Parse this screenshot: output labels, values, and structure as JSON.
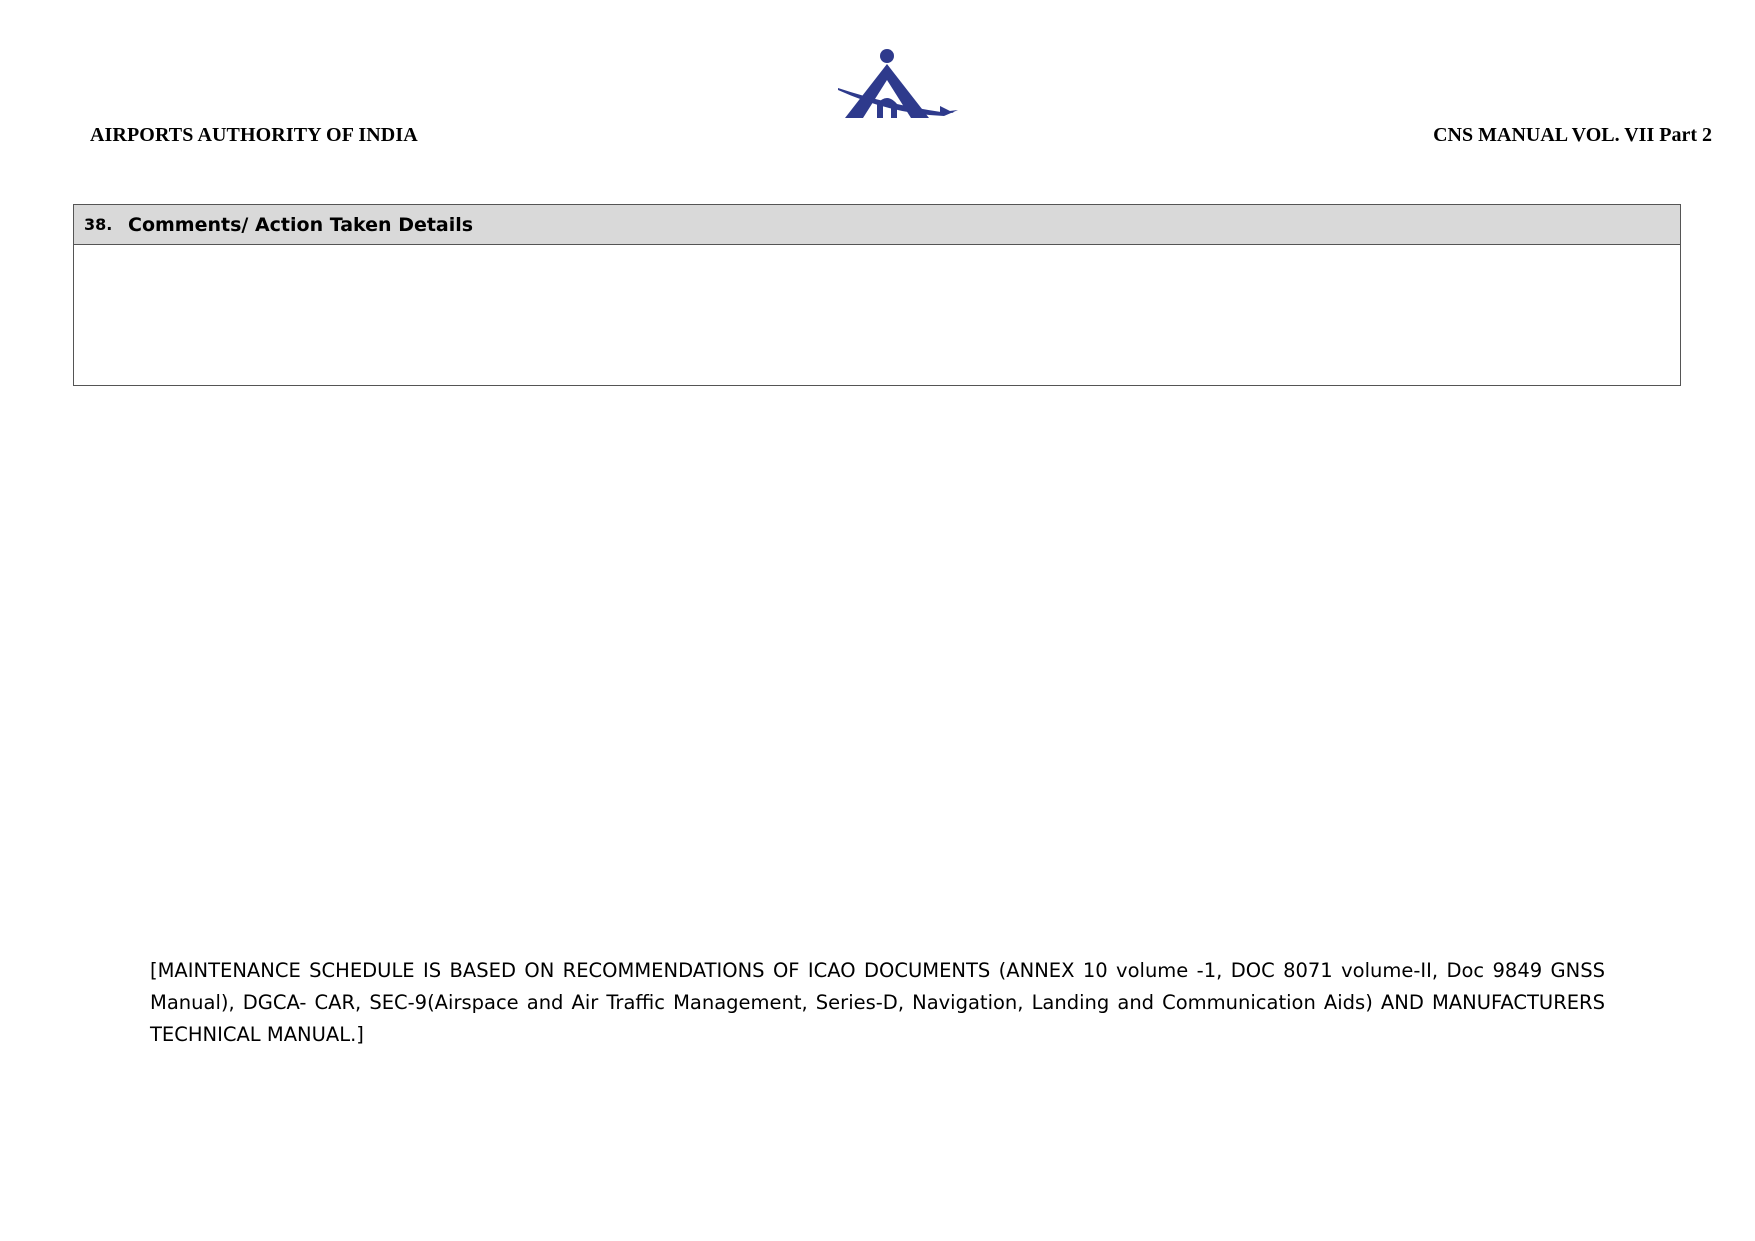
{
  "header": {
    "organization": "AIRPORTS AUTHORITY OF INDIA",
    "manual": "CNS MANUAL VOL. VII Part 2",
    "logo_color": "#2e3a8c"
  },
  "section": {
    "number": "38.",
    "title": "Comments/ Action Taken Details",
    "body": ""
  },
  "footer": {
    "note": "[MAINTENANCE SCHEDULE IS BASED ON RECOMMENDATIONS OF ICAO DOCUMENTS (ANNEX 10 volume -1, DOC 8071 volume-II, Doc 9849 GNSS Manual), DGCA- CAR, SEC-9(Airspace and Air Traffic Management, Series-D, Navigation, Landing and Communication Aids) AND MANUFACTURERS TECHNICAL MANUAL.]"
  }
}
